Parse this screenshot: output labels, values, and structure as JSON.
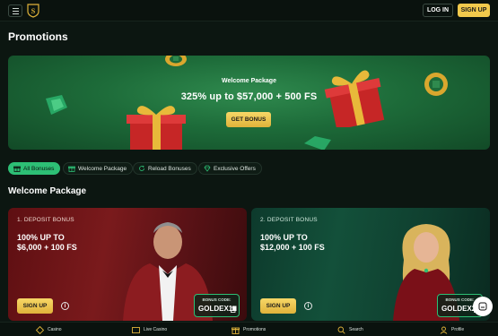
{
  "header": {
    "login_label": "LOG IN",
    "signup_label": "SIGN UP"
  },
  "page_title": "Promotions",
  "hero": {
    "subtitle": "Welcome Package",
    "title": "325% up to $57,000 + 500 FS",
    "button_label": "GET BONUS"
  },
  "filters": [
    {
      "label": "All Bonuses",
      "icon": "gift-icon",
      "active": true
    },
    {
      "label": "Welcome Package",
      "icon": "gift-icon",
      "active": false
    },
    {
      "label": "Reload Bonuses",
      "icon": "reload-icon",
      "active": false
    },
    {
      "label": "Exclusive Offers",
      "icon": "diamond-icon",
      "active": false
    }
  ],
  "section_title": "Welcome Package",
  "cards": [
    {
      "label": "1. DEPOSIT BONUS",
      "offer_line1": "100% UP TO",
      "offer_line2": "$6,000 + 100 FS",
      "button_label": "SIGN UP",
      "code_caption": "BONUS CODE:",
      "code": "GOLDEX1"
    },
    {
      "label": "2. DEPOSIT BONUS",
      "offer_line1": "100% UP TO",
      "offer_line2": "$12,000 + 100 FS",
      "button_label": "SIGN UP",
      "code_caption": "BONUS CODE:",
      "code": "GOLDEX2"
    }
  ],
  "bottom_nav": [
    {
      "label": "Casino",
      "icon": "casino-icon"
    },
    {
      "label": "Live Casino",
      "icon": "live-casino-icon"
    },
    {
      "label": "Promotions",
      "icon": "gift-icon"
    },
    {
      "label": "Search",
      "icon": "search-icon"
    },
    {
      "label": "Profile",
      "icon": "profile-icon"
    }
  ],
  "colors": {
    "accent_gold": "#f2c94c",
    "accent_green": "#2dbf75",
    "background": "#0c1611"
  }
}
